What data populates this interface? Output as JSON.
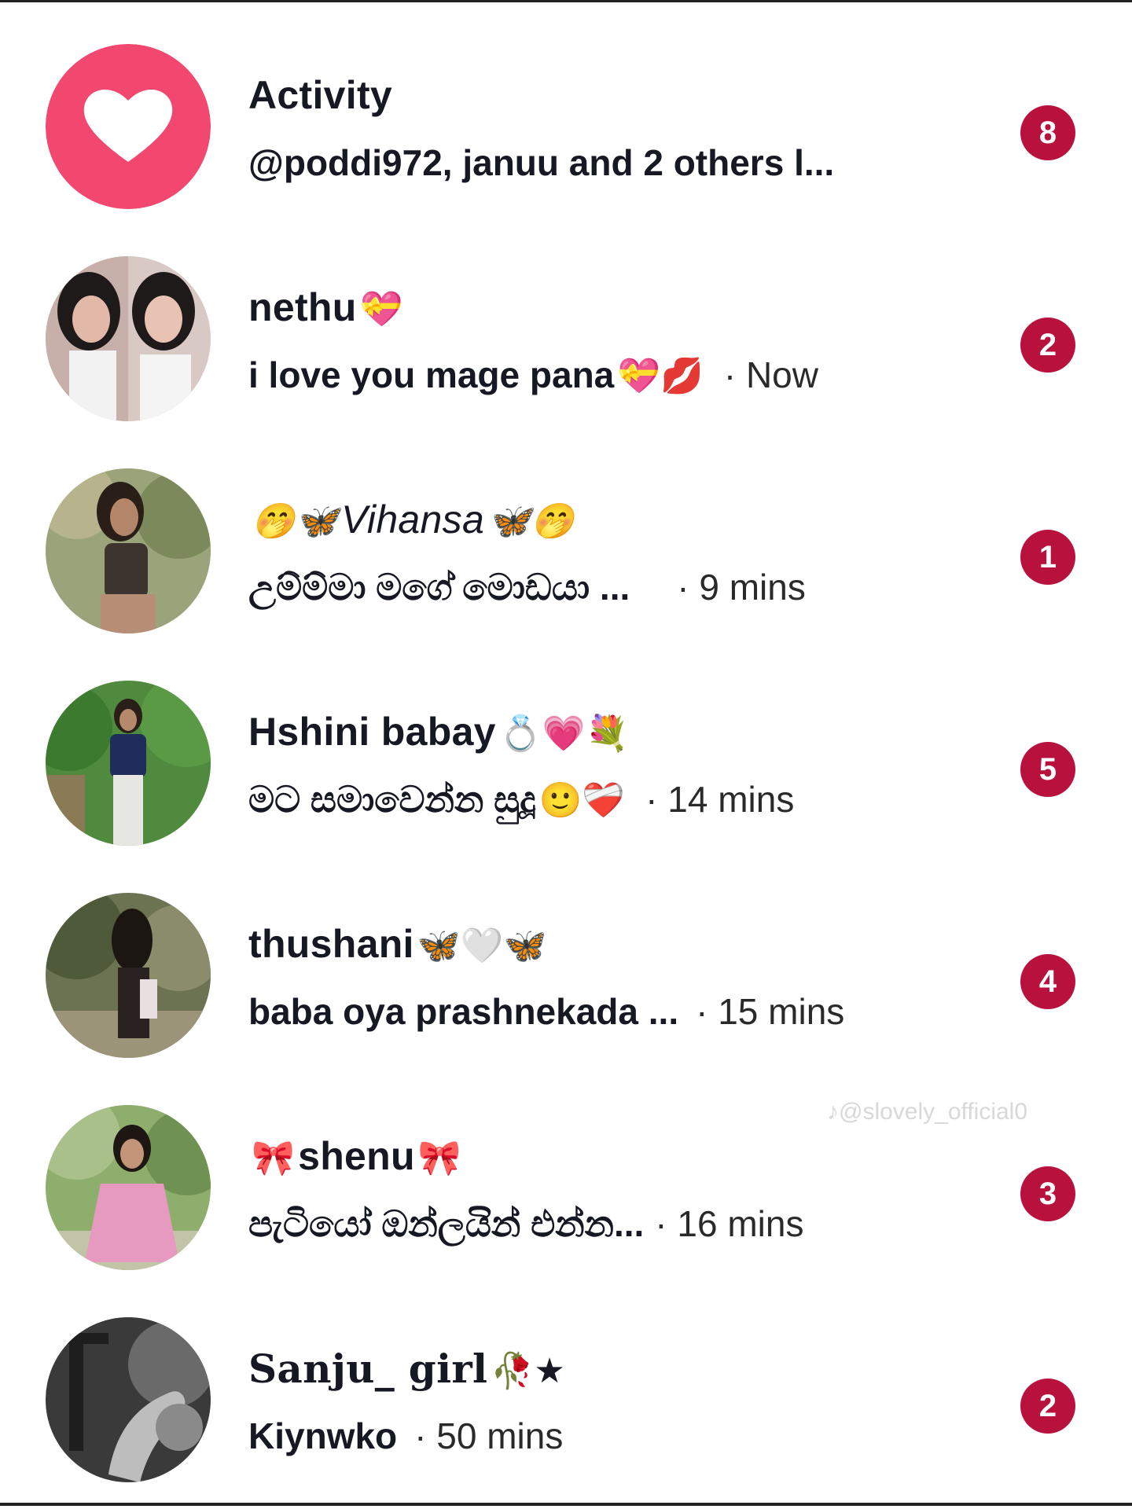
{
  "rows": [
    {
      "name": "Activity",
      "name_emoji_after": "",
      "name_emoji_before": "",
      "preview": "@poddi972, januu and 2 others l...",
      "preview_emoji": "",
      "time": "",
      "badge": "8",
      "avatar": "heart-icon"
    },
    {
      "name": "nethu",
      "name_emoji_after": "💝",
      "name_emoji_before": "",
      "preview": "i love you mage pana",
      "preview_emoji": "💝💋",
      "time": "· Now",
      "badge": "2",
      "avatar": "photo"
    },
    {
      "name": "Vihansa",
      "name_emoji_after": "🦋🤭",
      "name_emoji_before": "🤭🦋",
      "preview": "උම්ම්මා මගේ මොඩයා ...",
      "preview_emoji": "",
      "time": "· 9 mins",
      "badge": "1",
      "avatar": "photo"
    },
    {
      "name": "Hshini babay",
      "name_emoji_after": "💍💗💐",
      "name_emoji_before": "",
      "preview": "මට සමාවෙන්න සුදූ",
      "preview_emoji": "🙂❤️‍🩹",
      "time": "· 14 mins",
      "badge": "5",
      "avatar": "photo"
    },
    {
      "name": "thushani",
      "name_emoji_after": "🦋🤍🦋",
      "name_emoji_before": "",
      "preview": "baba oya prashnekada ...",
      "preview_emoji": "",
      "time": "· 15 mins",
      "badge": "4",
      "avatar": "photo"
    },
    {
      "name": "shenu",
      "name_emoji_after": "🎀",
      "name_emoji_before": "🎀",
      "preview": "පැටියෝ ඔන්ලයින් එන්න...",
      "preview_emoji": "",
      "time": "· 16 mins",
      "badge": "3",
      "avatar": "photo"
    },
    {
      "name": "Sanju_ girl",
      "name_emoji_after": "🥀★",
      "name_emoji_before": "",
      "preview": "Kiynwko",
      "preview_emoji": "",
      "time": "· 50 mins",
      "badge": "2",
      "avatar": "photo"
    }
  ],
  "watermark": "@slovely_official0",
  "colors": {
    "badge": "#b8113d",
    "activity_circle": "#f2476f",
    "text": "#161823"
  }
}
